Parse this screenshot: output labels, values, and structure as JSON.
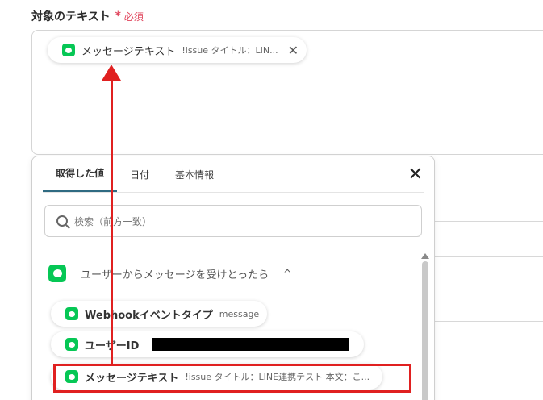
{
  "field": {
    "label": "対象のテキスト",
    "required_star": "*",
    "required_text": "必須"
  },
  "selected_chip": {
    "icon": "line-icon",
    "label": "メッセージテキスト",
    "preview": "!issue タイトル：LIN...",
    "close": "✕"
  },
  "panel": {
    "tabs": [
      "取得した値",
      "日付",
      "基本情報"
    ],
    "active_tab": "取得した値",
    "close": "✕",
    "search_placeholder": "検索（前方一致）",
    "group": {
      "label": "ユーザーからメッセージを受けとったら",
      "chevron": "^"
    },
    "items": [
      {
        "label": "Webhookイベントタイプ",
        "value": "message"
      },
      {
        "label": "ユーザーID",
        "value": ""
      },
      {
        "label": "メッセージテキスト",
        "value": "!issue タイトル：LINE連携テスト 本文：こ..."
      }
    ]
  },
  "colors": {
    "line_green": "#06c755",
    "required_red": "#e0455c",
    "annotation_red": "#e02020",
    "active_tab_underline": "#2f6b82"
  }
}
